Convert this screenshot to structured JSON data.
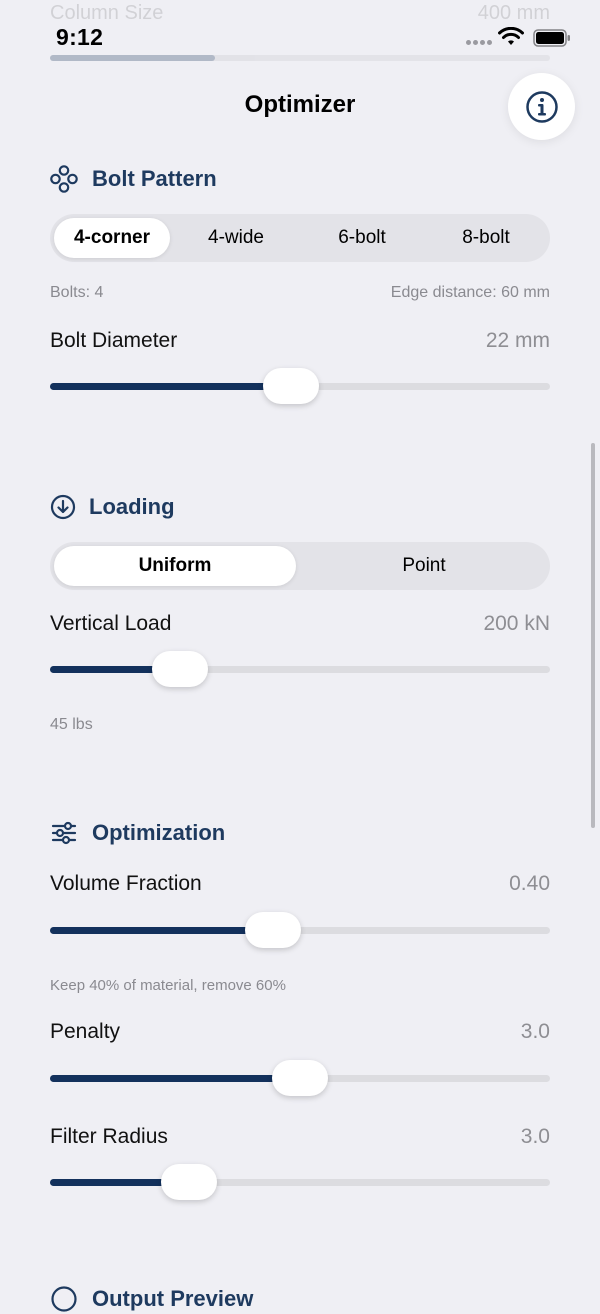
{
  "status_bar": {
    "time": "9:12"
  },
  "ghost_row": {
    "label": "Column Size",
    "value": "400 mm",
    "fill_fraction": 0.33
  },
  "nav": {
    "title": "Optimizer",
    "info_icon": "info-circle-icon"
  },
  "bolt_pattern": {
    "title": "Bolt Pattern",
    "icon": "bolt-pattern-icon",
    "options": [
      "4-corner",
      "4-wide",
      "6-bolt",
      "8-bolt"
    ],
    "selected": "4-corner",
    "bolts_text": "Bolts: 4",
    "edge_text": "Edge distance: 60 mm",
    "diameter": {
      "label": "Bolt Diameter",
      "value": "22 mm",
      "fraction": 0.48
    }
  },
  "loading": {
    "title": "Loading",
    "icon": "arrow-down-circle-icon",
    "options": [
      "Uniform",
      "Point"
    ],
    "selected": "Uniform",
    "vertical_load": {
      "label": "Vertical Load",
      "value": "200 kN",
      "fraction": 0.23
    },
    "note": "45 lbs"
  },
  "optimization": {
    "title": "Optimization",
    "icon": "sliders-icon",
    "volume_fraction": {
      "label": "Volume Fraction",
      "value": "0.40",
      "fraction": 0.44
    },
    "volume_note": "Keep 40% of material, remove 60%",
    "penalty": {
      "label": "Penalty",
      "value": "3.0",
      "fraction": 0.5
    },
    "filter_radius": {
      "label": "Filter Radius",
      "value": "3.0",
      "fraction": 0.25
    }
  },
  "next_section": {
    "title": "Output Preview",
    "icon": "eye-circle-icon"
  },
  "colors": {
    "accent": "#13315c",
    "section_title": "#1e3a5f",
    "background": "#efeff4"
  }
}
